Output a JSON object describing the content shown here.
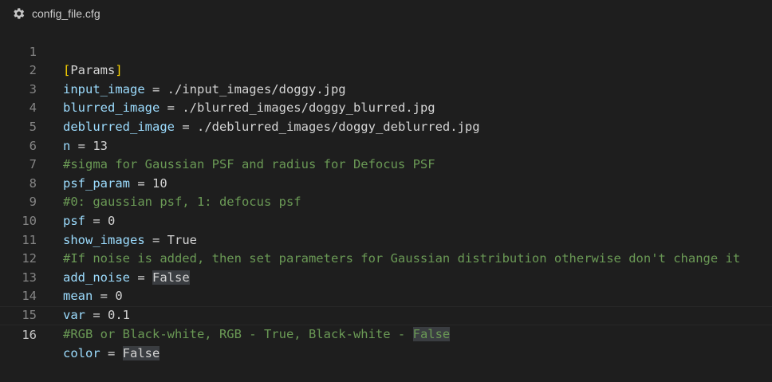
{
  "tab": {
    "filename": "config_file.cfg",
    "icon": "gear-icon"
  },
  "colors": {
    "background": "#1e1e1e",
    "key": "#9cdcfe",
    "value": "#d4d4d4",
    "comment": "#6a9955",
    "bracket": "#ffd700",
    "line_number": "#858585",
    "highlight": "#3a3d41"
  },
  "editor": {
    "current_line": 16,
    "lines": [
      {
        "num": "1",
        "bracket_open": "[",
        "section": "Params",
        "bracket_close": "]"
      },
      {
        "num": "2",
        "key": "input_image",
        "op": " = ",
        "value": "./input_images/doggy.jpg"
      },
      {
        "num": "3",
        "key": "blurred_image",
        "op": " = ",
        "value": "./blurred_images/doggy_blurred.jpg"
      },
      {
        "num": "4",
        "key": "deblurred_image",
        "op": " = ",
        "value": "./deblurred_images/doggy_deblurred.jpg"
      },
      {
        "num": "5",
        "key": "n",
        "op": " = ",
        "value": "13"
      },
      {
        "num": "6",
        "comment": "#sigma for Gaussian PSF and radius for Defocus PSF"
      },
      {
        "num": "7",
        "key": "psf_param",
        "op": " = ",
        "value": "10"
      },
      {
        "num": "8",
        "comment": "#0: gaussian psf, 1: defocus psf"
      },
      {
        "num": "9",
        "key": "psf",
        "op": " = ",
        "value": "0"
      },
      {
        "num": "10",
        "key": "show_images",
        "op": " = ",
        "value": "True"
      },
      {
        "num": "11",
        "comment": "#If noise is added, then set parameters for Gaussian distribution otherwise don't change it"
      },
      {
        "num": "12",
        "key": "add_noise",
        "op": " = ",
        "value": "False"
      },
      {
        "num": "13",
        "key": "mean",
        "op": " = ",
        "value": "0"
      },
      {
        "num": "14",
        "key": "var",
        "op": " = ",
        "value": "0.1"
      },
      {
        "num": "15",
        "comment": "#RGB or Black-white, RGB - True, Black-white - ",
        "comment_hl": "False"
      },
      {
        "num": "16",
        "key": "color",
        "op": " = ",
        "value": "False"
      }
    ]
  }
}
